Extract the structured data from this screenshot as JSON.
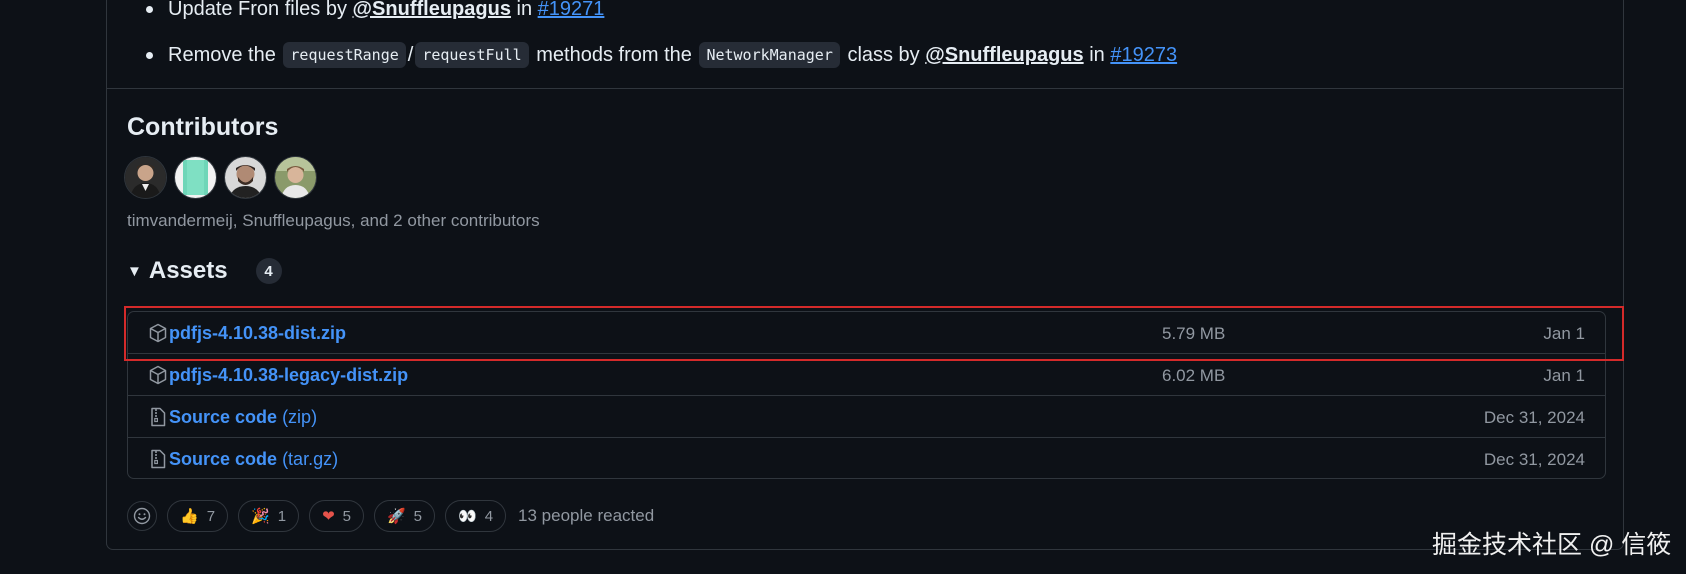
{
  "notes": {
    "line1": {
      "prefix": "Update Fron files by",
      "user": "@Snuffleupagus",
      "mid": "in",
      "issue": "#19271"
    },
    "line2": {
      "prefix": "Remove the",
      "code1": "requestRange",
      "slash": "/",
      "code2": "requestFull",
      "mid1": "methods from the",
      "code3": "NetworkManager",
      "mid2": "class by",
      "user": "@Snuffleupagus",
      "mid3": "in",
      "issue": "#19273"
    }
  },
  "contributors": {
    "title": "Contributors",
    "summary": "timvandermeij, Snuffleupagus, and 2 other contributors"
  },
  "assets": {
    "title": "Assets",
    "count": "4",
    "items": [
      {
        "name": "pdfjs-4.10.38-dist.zip",
        "ext": "",
        "size": "5.79 MB",
        "date": "Jan 1",
        "icon": "package-icon"
      },
      {
        "name": "pdfjs-4.10.38-legacy-dist.zip",
        "ext": "",
        "size": "6.02 MB",
        "date": "Jan 1",
        "icon": "package-icon"
      },
      {
        "name": "Source code",
        "ext": "(zip)",
        "size": "",
        "date": "Dec 31, 2024",
        "icon": "file-zip-icon"
      },
      {
        "name": "Source code",
        "ext": "(tar.gz)",
        "size": "",
        "date": "Dec 31, 2024",
        "icon": "file-zip-icon"
      }
    ]
  },
  "reactions": {
    "items": [
      {
        "emoji": "👍",
        "name": "thumbs-up",
        "count": "7"
      },
      {
        "emoji": "🎉",
        "name": "hooray",
        "count": "1"
      },
      {
        "emoji": "❤",
        "name": "heart",
        "count": "5"
      },
      {
        "emoji": "🚀",
        "name": "rocket",
        "count": "5"
      },
      {
        "emoji": "👀",
        "name": "eyes",
        "count": "4"
      }
    ],
    "summary": "13 people reacted"
  },
  "watermark": "掘金技术社区 @ 信筱",
  "colors": {
    "background": "#0d1117",
    "link": "#4493f8",
    "muted": "#9198a1",
    "border": "#30363d",
    "highlight": "#d42a2a"
  }
}
